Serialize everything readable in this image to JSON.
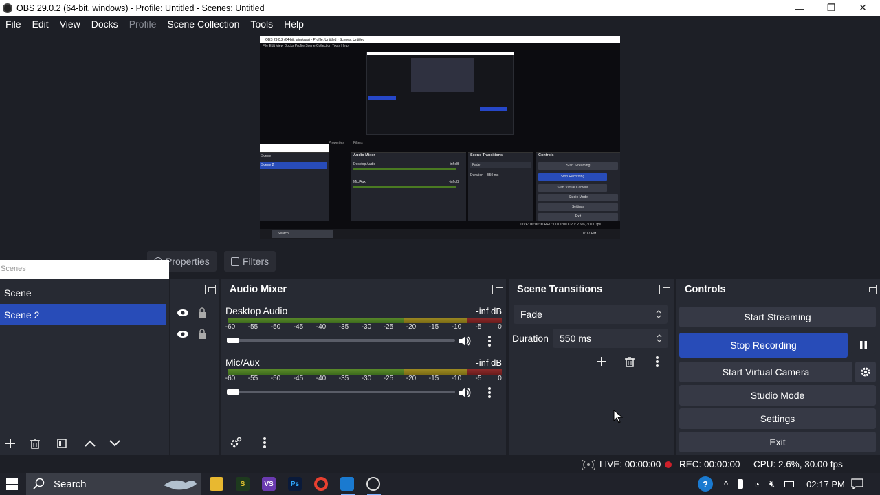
{
  "window": {
    "title": "OBS 29.0.2 (64-bit, windows) - Profile: Untitled - Scenes: Untitled",
    "minimize": "—",
    "restore": "❐",
    "close": "✕"
  },
  "menu": [
    "File",
    "Edit",
    "View",
    "Docks",
    "Profile",
    "Scene Collection",
    "Tools",
    "Help"
  ],
  "preview": {
    "title": "OBS 29.0.2 (64-bit, windows) - Profile: Untitled - Scenes: Untitled",
    "menu": "File   Edit   View   Docks   Profile   Scene Collection   Tools   Help",
    "scene_items": [
      "Scene",
      "Scene 2"
    ],
    "tabs": [
      "Properties",
      "Filters"
    ],
    "docks": [
      "Audio Mixer",
      "Scene Transitions",
      "Controls"
    ],
    "channels": [
      "Desktop Audio",
      "Mic/Aux"
    ],
    "db": "-inf dB",
    "transition": "Fade",
    "duration_label": "Duration",
    "duration_value": "550 ms",
    "controls": [
      "Start Streaming",
      "Stop Recording",
      "Start Virtual Camera",
      "Studio Mode",
      "Settings",
      "Exit"
    ],
    "status": "LIVE: 00:00:00    REC: 00:00:00    CPU: 2.6%, 30.00 fps",
    "search": "Search",
    "clock": "02:17 PM"
  },
  "tabs": {
    "properties": "Properties",
    "filters": "Filters"
  },
  "scenes": {
    "header": "Scenes",
    "items": [
      {
        "label": "Scene",
        "selected": false
      },
      {
        "label": "Scene 2",
        "selected": true
      }
    ]
  },
  "audio_mixer": {
    "title": "Audio Mixer",
    "channels": [
      {
        "name": "Desktop Audio",
        "db": "-inf dB"
      },
      {
        "name": "Mic/Aux",
        "db": "-inf dB"
      }
    ],
    "ticks": [
      "-60",
      "-55",
      "-50",
      "-45",
      "-40",
      "-35",
      "-30",
      "-25",
      "-20",
      "-15",
      "-10",
      "-5",
      "0"
    ]
  },
  "scene_transitions": {
    "title": "Scene Transitions",
    "transition": "Fade",
    "duration_label": "Duration",
    "duration_value": "550 ms"
  },
  "controls": {
    "title": "Controls",
    "start_streaming": "Start Streaming",
    "stop_recording": "Stop Recording",
    "start_virtual_camera": "Start Virtual Camera",
    "studio_mode": "Studio Mode",
    "settings": "Settings",
    "exit": "Exit"
  },
  "status": {
    "live": "LIVE: 00:00:00",
    "rec": "REC: 00:00:00",
    "cpu": "CPU: 2.6%, 30.00 fps"
  },
  "taskbar": {
    "search": "Search",
    "clock": "02:17 PM"
  },
  "colors": {
    "accent": "#284cb8",
    "background": "#1d1f26",
    "panel": "#272a33",
    "rec_dot": "#d0202a"
  }
}
